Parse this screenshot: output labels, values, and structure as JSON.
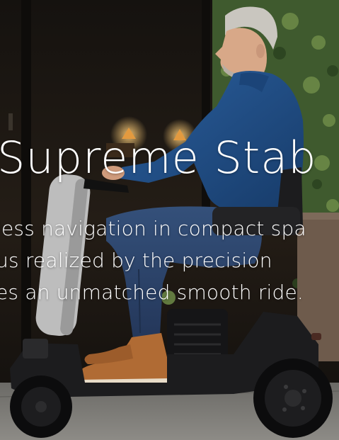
{
  "hero": {
    "headline": "Supreme Stab",
    "lines": [
      "less navigation in compact spa",
      "us realized by the precision",
      "es an unmatched smooth ride."
    ]
  },
  "palette": {
    "background": "#1a1714",
    "foliage": "#3f5a2e",
    "sweater": "#1f4e86",
    "jeans": "#2b3f63",
    "boots": "#b06b34",
    "scooter": "#1c1c1e",
    "text": "#ffffff"
  }
}
